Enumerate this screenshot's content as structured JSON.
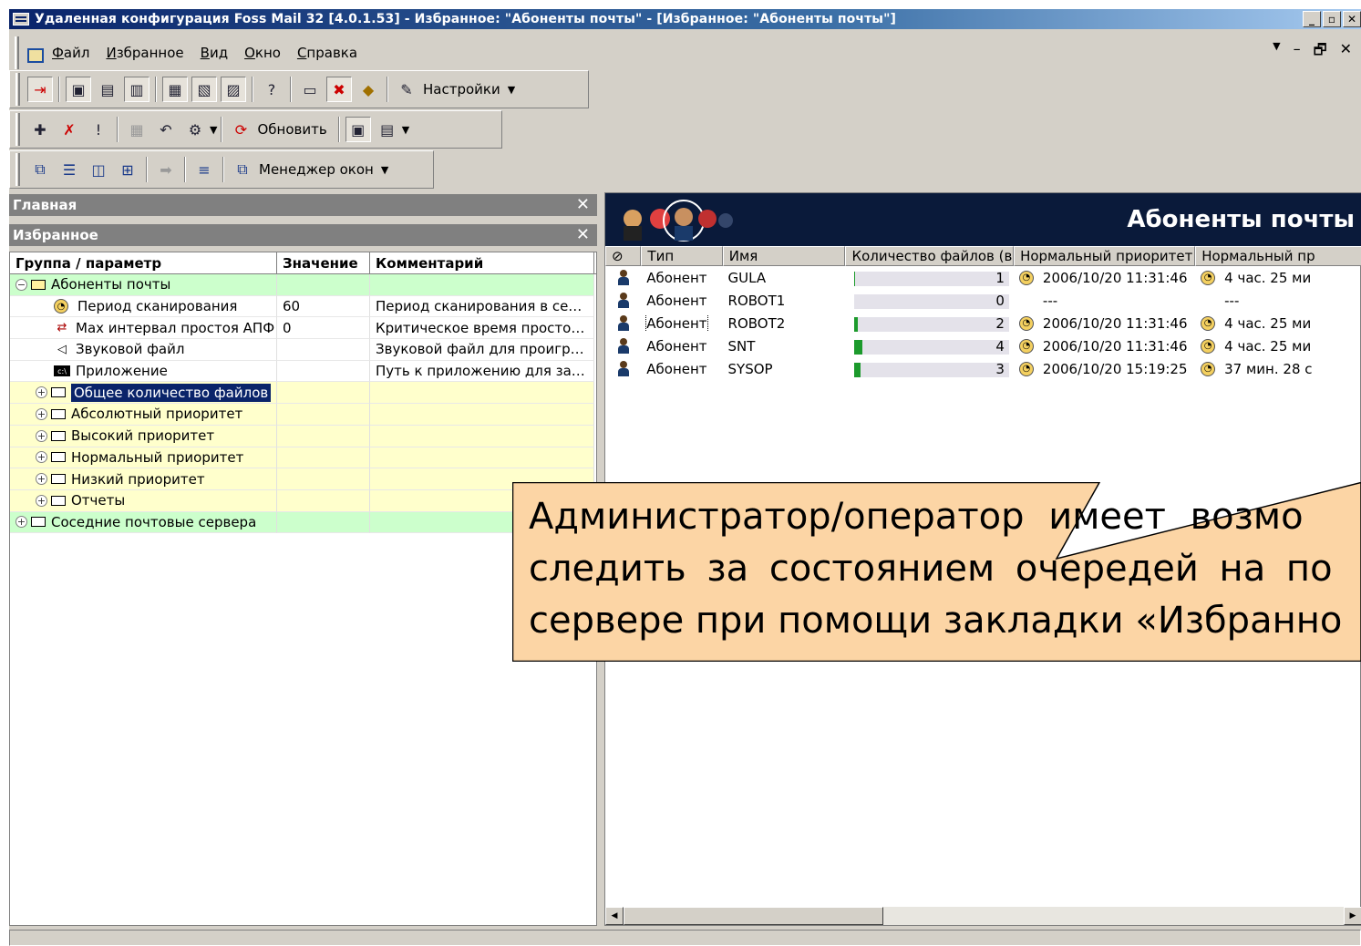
{
  "window": {
    "title": "Удаленная конфигурация Foss Mail 32 [4.0.1.53] - Избранное: \"Абоненты почты\" - [Избранное: \"Абоненты почты\"]",
    "controls": [
      "_",
      "▫",
      "✕"
    ]
  },
  "menu": {
    "items": [
      "Файл",
      "Избранное",
      "Вид",
      "Окно",
      "Справка"
    ],
    "mdi_controls": [
      "–",
      "🗗",
      "✕"
    ]
  },
  "toolbar1": {
    "settings_label": "Настройки"
  },
  "toolbar2": {
    "refresh_label": "Обновить"
  },
  "toolbar3": {
    "window_manager_label": "Менеджер окон"
  },
  "left_pane": {
    "caption_main": "Главная",
    "caption_favorites": "Избранное",
    "columns": [
      "Группа / параметр",
      "Значение",
      "Комментарий"
    ],
    "rows": [
      {
        "name": "Абоненты почты",
        "value": "",
        "comment": ""
      },
      {
        "name": "Период сканирования",
        "value": "60",
        "comment": "Период сканирования в се…"
      },
      {
        "name": "Max интервал простоя АПФ",
        "value": "0",
        "comment": "Критическое время просто…"
      },
      {
        "name": "Звуковой файл",
        "value": "",
        "comment": "Звуковой файл для проигр…"
      },
      {
        "name": "Приложение",
        "value": "",
        "comment": "Путь к приложению для за…"
      },
      {
        "name": "Общее количество файлов",
        "value": "",
        "comment": ""
      },
      {
        "name": "Абсолютный приоритет",
        "value": "",
        "comment": ""
      },
      {
        "name": "Высокий приоритет",
        "value": "",
        "comment": ""
      },
      {
        "name": "Нормальный приоритет",
        "value": "",
        "comment": ""
      },
      {
        "name": "Низкий приоритет",
        "value": "",
        "comment": ""
      },
      {
        "name": "Отчеты",
        "value": "",
        "comment": ""
      },
      {
        "name": "Соседние почтовые сервера",
        "value": "",
        "comment": ""
      }
    ]
  },
  "right_pane": {
    "banner_title": "Абоненты почты",
    "columns": [
      "Тип",
      "Имя",
      "Количество файлов (вс…",
      "Нормальный приоритет -…",
      "Нормальный пр"
    ],
    "rows": [
      {
        "type": "Абонент",
        "name": "GULA",
        "count": "1",
        "count_fraction": 0.01,
        "date": "2006/10/20  11:31:46",
        "duration": "4 час. 25 ми"
      },
      {
        "type": "Абонент",
        "name": "ROBOT1",
        "count": "0",
        "count_fraction": 0.0,
        "date": "---",
        "duration": "---"
      },
      {
        "type": "Абонент",
        "name": "ROBOT2",
        "count": "2",
        "count_fraction": 0.02,
        "date": "2006/10/20  11:31:46",
        "duration": "4 час. 25 ми"
      },
      {
        "type": "Абонент",
        "name": "SNT",
        "count": "4",
        "count_fraction": 0.05,
        "date": "2006/10/20  11:31:46",
        "duration": "4 час. 25 ми"
      },
      {
        "type": "Абонент",
        "name": "SYSOP",
        "count": "3",
        "count_fraction": 0.04,
        "date": "2006/10/20  15:19:25",
        "duration": "37 мин. 28 с"
      }
    ]
  },
  "callout": {
    "line1": "Администратор/оператор имеет возмо",
    "line2": "следить за состоянием очередей на по",
    "line3": "сервере при помощи закладки «Избранно"
  },
  "colors": {
    "title_bar": "#0a246a",
    "group_green": "#ccffcc",
    "group_yellow": "#ffffcc",
    "selection": "#0a246a",
    "progress": "#1c9a2c",
    "callout_fill": "#fcd5a5"
  }
}
